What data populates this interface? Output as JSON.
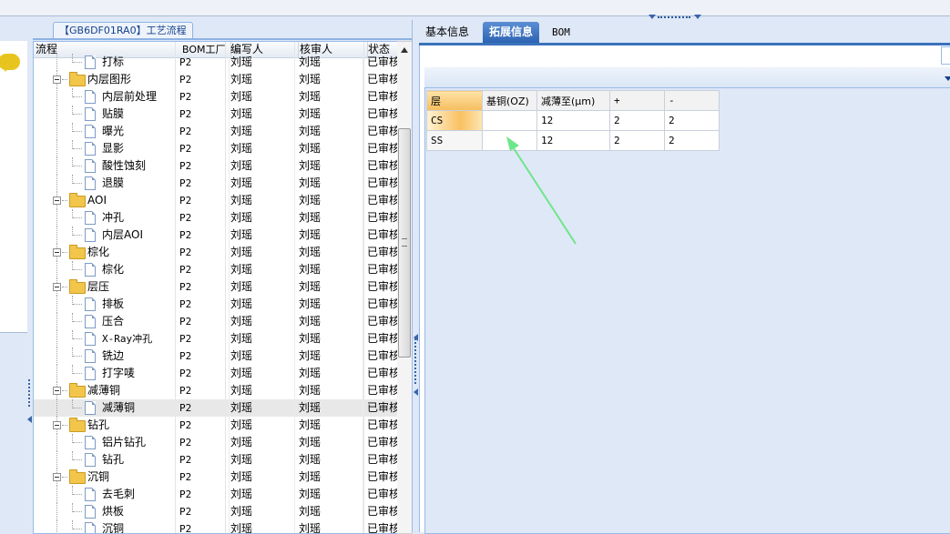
{
  "left_panel": {
    "tab_title": "【GB6DF01RA0】工艺流程",
    "columns": [
      "流程",
      "BOM工厂",
      "编写人",
      "核审人",
      "状态"
    ],
    "rows": [
      {
        "name": "打标",
        "level": 2,
        "type": "doc",
        "bom": "P2",
        "writer": "刘瑶",
        "reviewer": "刘瑶",
        "status": "已审核"
      },
      {
        "name": "内层图形",
        "level": 1,
        "type": "folder",
        "bom": "P2",
        "writer": "刘瑶",
        "reviewer": "刘瑶",
        "status": "已审核"
      },
      {
        "name": "内层前处理",
        "level": 2,
        "type": "doc",
        "bom": "P2",
        "writer": "刘瑶",
        "reviewer": "刘瑶",
        "status": "已审核"
      },
      {
        "name": "贴膜",
        "level": 2,
        "type": "doc",
        "bom": "P2",
        "writer": "刘瑶",
        "reviewer": "刘瑶",
        "status": "已审核"
      },
      {
        "name": "曝光",
        "level": 2,
        "type": "doc",
        "bom": "P2",
        "writer": "刘瑶",
        "reviewer": "刘瑶",
        "status": "已审核"
      },
      {
        "name": "显影",
        "level": 2,
        "type": "doc",
        "bom": "P2",
        "writer": "刘瑶",
        "reviewer": "刘瑶",
        "status": "已审核"
      },
      {
        "name": "酸性蚀刻",
        "level": 2,
        "type": "doc",
        "bom": "P2",
        "writer": "刘瑶",
        "reviewer": "刘瑶",
        "status": "已审核"
      },
      {
        "name": "退膜",
        "level": 2,
        "type": "doc",
        "bom": "P2",
        "writer": "刘瑶",
        "reviewer": "刘瑶",
        "status": "已审核"
      },
      {
        "name": "AOI",
        "level": 1,
        "type": "folder",
        "bom": "P2",
        "writer": "刘瑶",
        "reviewer": "刘瑶",
        "status": "已审核"
      },
      {
        "name": "冲孔",
        "level": 2,
        "type": "doc",
        "bom": "P2",
        "writer": "刘瑶",
        "reviewer": "刘瑶",
        "status": "已审核"
      },
      {
        "name": "内层AOI",
        "level": 2,
        "type": "doc",
        "bom": "P2",
        "writer": "刘瑶",
        "reviewer": "刘瑶",
        "status": "已审核"
      },
      {
        "name": "棕化",
        "level": 1,
        "type": "folder",
        "bom": "P2",
        "writer": "刘瑶",
        "reviewer": "刘瑶",
        "status": "已审核"
      },
      {
        "name": "棕化",
        "level": 2,
        "type": "doc",
        "bom": "P2",
        "writer": "刘瑶",
        "reviewer": "刘瑶",
        "status": "已审核"
      },
      {
        "name": "层压",
        "level": 1,
        "type": "folder",
        "bom": "P2",
        "writer": "刘瑶",
        "reviewer": "刘瑶",
        "status": "已审核"
      },
      {
        "name": "排板",
        "level": 2,
        "type": "doc",
        "bom": "P2",
        "writer": "刘瑶",
        "reviewer": "刘瑶",
        "status": "已审核"
      },
      {
        "name": "压合",
        "level": 2,
        "type": "doc",
        "bom": "P2",
        "writer": "刘瑶",
        "reviewer": "刘瑶",
        "status": "已审核"
      },
      {
        "name": "X-Ray冲孔",
        "level": 2,
        "type": "doc",
        "bom": "P2",
        "writer": "刘瑶",
        "reviewer": "刘瑶",
        "status": "已审核"
      },
      {
        "name": "铣边",
        "level": 2,
        "type": "doc",
        "bom": "P2",
        "writer": "刘瑶",
        "reviewer": "刘瑶",
        "status": "已审核"
      },
      {
        "name": "打字唛",
        "level": 2,
        "type": "doc",
        "bom": "P2",
        "writer": "刘瑶",
        "reviewer": "刘瑶",
        "status": "已审核"
      },
      {
        "name": "减薄铜",
        "level": 1,
        "type": "folder",
        "bom": "P2",
        "writer": "刘瑶",
        "reviewer": "刘瑶",
        "status": "已审核"
      },
      {
        "name": "减薄铜",
        "level": 2,
        "type": "doc",
        "bom": "P2",
        "writer": "刘瑶",
        "reviewer": "刘瑶",
        "status": "已审核",
        "selected": true
      },
      {
        "name": "钻孔",
        "level": 1,
        "type": "folder",
        "bom": "P2",
        "writer": "刘瑶",
        "reviewer": "刘瑶",
        "status": "已审核"
      },
      {
        "name": "铝片钻孔",
        "level": 2,
        "type": "doc",
        "bom": "P2",
        "writer": "刘瑶",
        "reviewer": "刘瑶",
        "status": "已审核"
      },
      {
        "name": "钻孔",
        "level": 2,
        "type": "doc",
        "bom": "P2",
        "writer": "刘瑶",
        "reviewer": "刘瑶",
        "status": "已审核"
      },
      {
        "name": "沉铜",
        "level": 1,
        "type": "folder",
        "bom": "P2",
        "writer": "刘瑶",
        "reviewer": "刘瑶",
        "status": "已审核"
      },
      {
        "name": "去毛刺",
        "level": 2,
        "type": "doc",
        "bom": "P2",
        "writer": "刘瑶",
        "reviewer": "刘瑶",
        "status": "已审核"
      },
      {
        "name": "烘板",
        "level": 2,
        "type": "doc",
        "bom": "P2",
        "writer": "刘瑶",
        "reviewer": "刘瑶",
        "status": "已审核"
      },
      {
        "name": "沉铜",
        "level": 2,
        "type": "doc",
        "bom": "P2",
        "writer": "刘瑶",
        "reviewer": "刘瑶",
        "status": "已审核"
      }
    ]
  },
  "right_panel": {
    "tabs": [
      {
        "label": "基本信息",
        "active": false
      },
      {
        "label": "拓展信息",
        "active": true
      },
      {
        "label": "BOM",
        "active": false
      }
    ],
    "table": {
      "headers": [
        "层",
        "基铜(OZ)",
        "减薄至(μm)",
        "+",
        "-"
      ],
      "rows": [
        [
          "CS",
          "",
          "12",
          "2",
          "2"
        ],
        [
          "SS",
          "",
          "12",
          "2",
          "2"
        ]
      ]
    }
  },
  "colors": {
    "accent": "#2d63b2",
    "panel_bg": "#dfe8f6",
    "annotation_arrow": "#6ee68a"
  }
}
